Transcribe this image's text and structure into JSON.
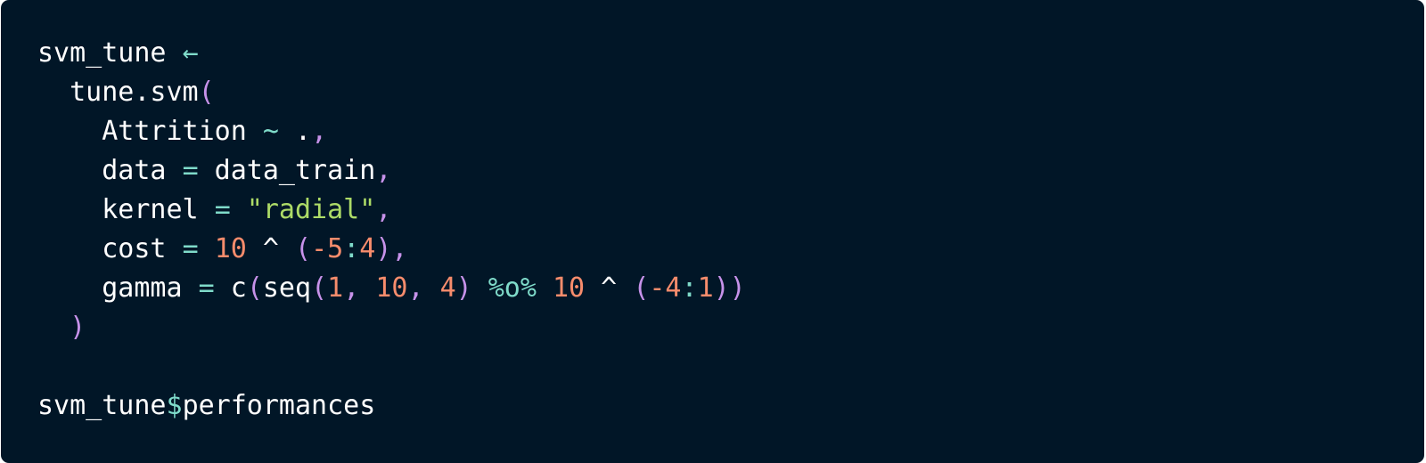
{
  "colors": {
    "background": "#011627",
    "identifier": "#ffffff",
    "operator": "#7fdbca",
    "paren": "#c792ea",
    "number": "#f78c6c",
    "string": "#addb67",
    "dollar": "#7fdbca"
  },
  "code": {
    "lines": [
      {
        "tokens": [
          {
            "text": "svm_tune ",
            "kind": "identifier"
          },
          {
            "text": "←",
            "kind": "operator"
          }
        ]
      },
      {
        "tokens": [
          {
            "text": "  tune.svm",
            "kind": "identifier"
          },
          {
            "text": "(",
            "kind": "paren"
          }
        ]
      },
      {
        "tokens": [
          {
            "text": "    Attrition ",
            "kind": "identifier"
          },
          {
            "text": "~",
            "kind": "operator"
          },
          {
            "text": " .",
            "kind": "identifier"
          },
          {
            "text": ",",
            "kind": "paren"
          }
        ]
      },
      {
        "tokens": [
          {
            "text": "    data ",
            "kind": "identifier"
          },
          {
            "text": "=",
            "kind": "operator"
          },
          {
            "text": " data_train",
            "kind": "identifier"
          },
          {
            "text": ",",
            "kind": "paren"
          }
        ]
      },
      {
        "tokens": [
          {
            "text": "    kernel ",
            "kind": "identifier"
          },
          {
            "text": "=",
            "kind": "operator"
          },
          {
            "text": " ",
            "kind": "identifier"
          },
          {
            "text": "\"radial\"",
            "kind": "string"
          },
          {
            "text": ",",
            "kind": "paren"
          }
        ]
      },
      {
        "tokens": [
          {
            "text": "    cost ",
            "kind": "identifier"
          },
          {
            "text": "=",
            "kind": "operator"
          },
          {
            "text": " ",
            "kind": "identifier"
          },
          {
            "text": "10",
            "kind": "number"
          },
          {
            "text": " ^ ",
            "kind": "identifier"
          },
          {
            "text": "(",
            "kind": "paren"
          },
          {
            "text": "-5",
            "kind": "number"
          },
          {
            "text": ":",
            "kind": "operator"
          },
          {
            "text": "4",
            "kind": "number"
          },
          {
            "text": ")",
            "kind": "paren"
          },
          {
            "text": ",",
            "kind": "paren"
          }
        ]
      },
      {
        "tokens": [
          {
            "text": "    gamma ",
            "kind": "identifier"
          },
          {
            "text": "=",
            "kind": "operator"
          },
          {
            "text": " c",
            "kind": "identifier"
          },
          {
            "text": "(",
            "kind": "paren"
          },
          {
            "text": "seq",
            "kind": "identifier"
          },
          {
            "text": "(",
            "kind": "paren"
          },
          {
            "text": "1",
            "kind": "number"
          },
          {
            "text": ", ",
            "kind": "paren"
          },
          {
            "text": "10",
            "kind": "number"
          },
          {
            "text": ", ",
            "kind": "paren"
          },
          {
            "text": "4",
            "kind": "number"
          },
          {
            "text": ")",
            "kind": "paren"
          },
          {
            "text": " ",
            "kind": "identifier"
          },
          {
            "text": "%o%",
            "kind": "operator"
          },
          {
            "text": " ",
            "kind": "identifier"
          },
          {
            "text": "10",
            "kind": "number"
          },
          {
            "text": " ^ ",
            "kind": "identifier"
          },
          {
            "text": "(",
            "kind": "paren"
          },
          {
            "text": "-4",
            "kind": "number"
          },
          {
            "text": ":",
            "kind": "operator"
          },
          {
            "text": "1",
            "kind": "number"
          },
          {
            "text": "))",
            "kind": "paren"
          }
        ]
      },
      {
        "tokens": [
          {
            "text": "  ",
            "kind": "identifier"
          },
          {
            "text": ")",
            "kind": "paren"
          }
        ]
      },
      {
        "tokens": [
          {
            "text": "",
            "kind": "identifier"
          }
        ]
      },
      {
        "tokens": [
          {
            "text": "svm_tune",
            "kind": "identifier"
          },
          {
            "text": "$",
            "kind": "dollar"
          },
          {
            "text": "performances",
            "kind": "identifier"
          }
        ]
      }
    ]
  }
}
